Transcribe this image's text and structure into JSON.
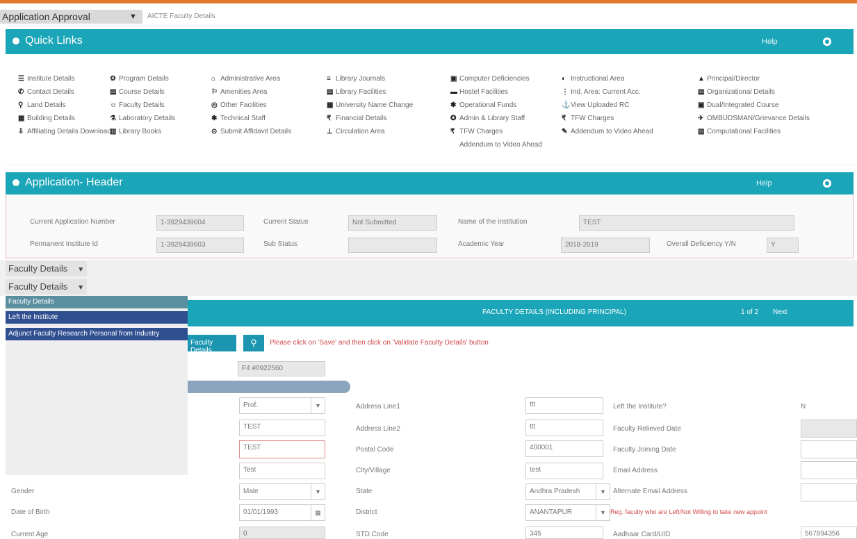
{
  "top": {
    "app_select": "Application Approval",
    "breadcrumb": "AICTE Faculty Details"
  },
  "quick_links": {
    "title": "Quick Links",
    "right_label": "Help",
    "columns": [
      [
        {
          "icon": "☰",
          "label": "Institute Details"
        },
        {
          "icon": "✆",
          "label": "Contact Details"
        },
        {
          "icon": "⚲",
          "label": "Land Details"
        },
        {
          "icon": "▦",
          "label": "Building Details"
        },
        {
          "icon": "⇩",
          "label": "Affiliating Details Download"
        }
      ],
      [
        {
          "icon": "⚙",
          "label": "Program Details"
        },
        {
          "icon": "▤",
          "label": "Course Details"
        },
        {
          "icon": "☺",
          "label": "Faculty Details"
        },
        {
          "icon": "⚗",
          "label": "Laboratory Details"
        },
        {
          "icon": "▥",
          "label": "Library Books"
        }
      ],
      [
        {
          "icon": "⌂",
          "label": "Administrative Area"
        },
        {
          "icon": "⚐",
          "label": "Amenities Area"
        },
        {
          "icon": "◎",
          "label": "Other Facilities"
        },
        {
          "icon": "✱",
          "label": "Technical Staff"
        },
        {
          "icon": "⊙",
          "label": "Submit Affidavit Details"
        }
      ],
      [
        {
          "icon": "≡",
          "label": "Library Journals"
        },
        {
          "icon": "▤",
          "label": "Library Facilities"
        },
        {
          "icon": "▦",
          "label": "University Name Change"
        },
        {
          "icon": "₹",
          "label": "Financial Details"
        },
        {
          "icon": "⊥",
          "label": "Circulation Area"
        }
      ],
      [
        {
          "icon": "▣",
          "label": "Computer Deficiencies"
        },
        {
          "icon": "▬",
          "label": "Hostel Facilities"
        },
        {
          "icon": "✽",
          "label": "Operational Funds"
        },
        {
          "icon": "✪",
          "label": "Admin & Library Staff"
        },
        {
          "icon": "₹",
          "label": "TFW Charges"
        },
        {
          "icon": "",
          "label": "Addendum to Video Ahead"
        }
      ],
      [
        {
          "icon": "◐",
          "label": "Instructional Area"
        },
        {
          "icon": "⋮",
          "label": "Ind. Area: Current Acc."
        },
        {
          "icon": "⚓",
          "label": "View Uploaded RC"
        },
        {
          "icon": "₹",
          "label": "TFW Charges"
        },
        {
          "icon": "✎",
          "label": "Addendum to Video Ahead"
        }
      ],
      [
        {
          "icon": "▲",
          "label": "Principal/Director"
        },
        {
          "icon": "▤",
          "label": "Organizational Details"
        },
        {
          "icon": "▣",
          "label": "Dual/Integrated Course"
        },
        {
          "icon": "✈",
          "label": "OMBUDSMAN/Grievance Details"
        },
        {
          "icon": "▧",
          "label": "Computational Facilities"
        }
      ]
    ]
  },
  "app_header": {
    "title": "Application- Header",
    "right_label": "Help",
    "fields": {
      "current_app_label": "Current Application Number",
      "current_app_value": "1-3929439604",
      "current_status_label": "Current Status",
      "current_status_value": "Not Submitted",
      "inst_name_label": "Name of the institution",
      "inst_name_value": "TEST",
      "perm_id_label": "Permanent Institute Id",
      "perm_id_value": "1-3929439603",
      "sub_status_label": "Sub Status",
      "sub_status_value": "",
      "academic_year_label": "Academic Year",
      "academic_year_value": "2018-2019",
      "overall_def_label": "Overall Deficiency Y/N",
      "overall_def_value": "Y"
    }
  },
  "faculty_dropdowns": [
    "Faculty Details",
    "Faculty Details"
  ],
  "faculty_menu": [
    "Faculty Details",
    "Left the Institute",
    "Adjunct Faculty Research Personal from Industry"
  ],
  "faculty_section": {
    "band_title": "FACULTY DETAILS (INCLUDING PRINCIPAL)",
    "band_pages": "1 of 2",
    "band_next": "Next",
    "faculty_button": "Faculty Details",
    "message": "Please click on 'Save' and then click on 'Validate Faculty Details' button",
    "id_value": "F4 #0922560"
  },
  "form": {
    "title_value": "Prof.",
    "first_name": "TEST",
    "middle_name": "TEST",
    "last_name": "Test",
    "gender_label": "Gender",
    "gender_value": "Male",
    "dob_label": "Date of Birth",
    "dob_value": "01/01/1993",
    "age_label": "Current Age",
    "age_value": "0",
    "addr1_label": "Address Line1",
    "addr1_value": "ttt",
    "addr2_label": "Address Line2",
    "addr2_value": "ttt",
    "postal_label": "Postal Code",
    "postal_value": "400001",
    "city_label": "City/Village",
    "city_value": "test",
    "state_label": "State",
    "state_value": "Andhra Pradesh",
    "district_label": "District",
    "district_value": "ANANTAPUR",
    "std_label": "STD Code",
    "std_value": "345",
    "left_label": "Left the Institute?",
    "left_value": "N",
    "relieved_label": "Faculty Relieved Date",
    "joining_label": "Faculty Joining Date",
    "email_label": "Email Address",
    "alt_email_label": "Alternate Email Address",
    "aadhaar_label": "Aadhaar Card/UID",
    "aadhaar_value": "567894356",
    "warning": "Reg. faculty who are Left/Not Willing to take new appoint"
  },
  "colors": {
    "teal": "#1ba5b8",
    "orange": "#e07a2a",
    "menu_selected": "#2f4f91",
    "menu_header": "#5a8fa0"
  }
}
